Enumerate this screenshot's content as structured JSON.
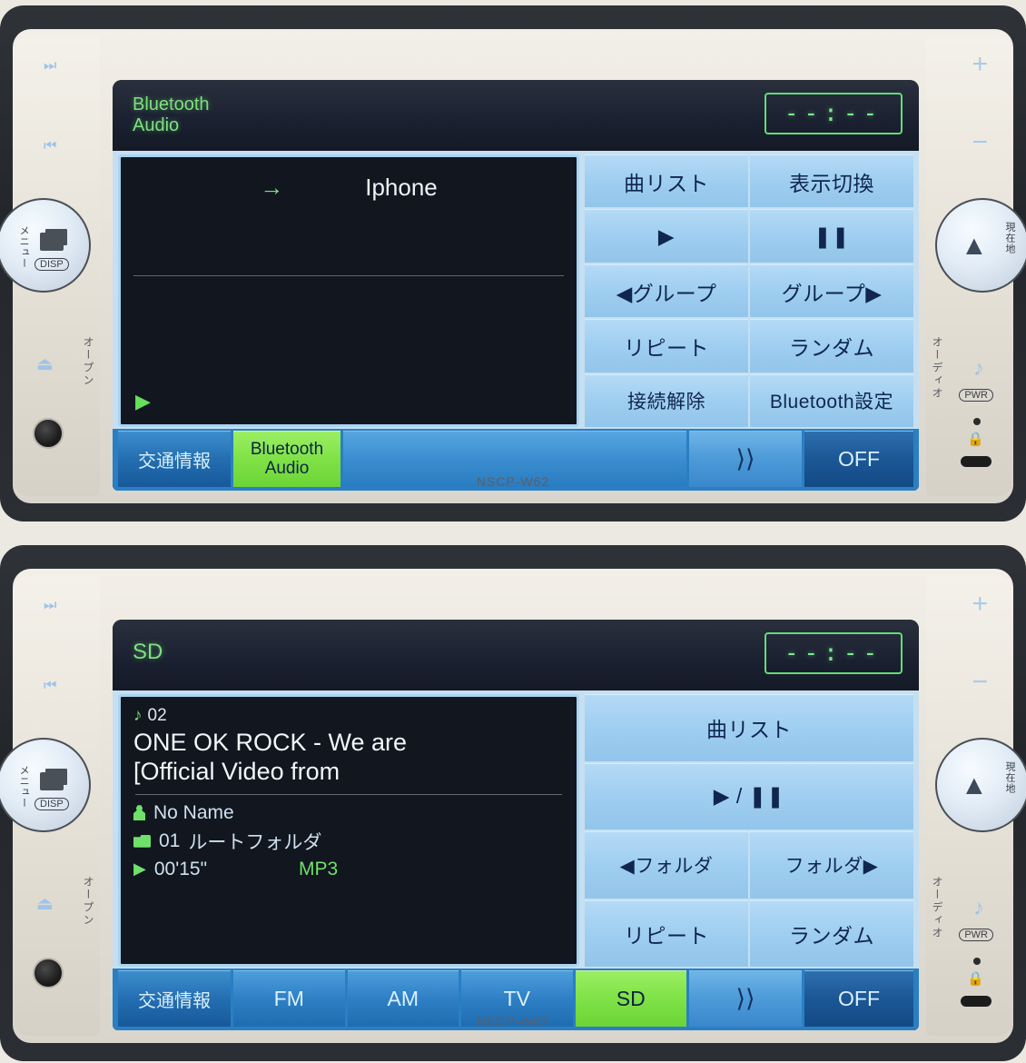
{
  "model_label": "NSCP-W62",
  "units": [
    {
      "id": "bluetooth-audio-unit",
      "source_title": "Bluetooth\nAudio",
      "source_title_line1": "Bluetooth",
      "source_title_line2": "Audio",
      "clock": "--:--",
      "info": {
        "mode": "bluetooth",
        "arrow_icon": "→",
        "device_name": "Iphone",
        "play_icon": "▶"
      },
      "function_buttons": [
        [
          {
            "label": "曲リスト",
            "name": "track-list-button"
          },
          {
            "label": "表示切換",
            "name": "display-switch-button"
          }
        ],
        [
          {
            "label": "▶",
            "name": "play-button"
          },
          {
            "label": "❚❚",
            "name": "pause-button"
          }
        ],
        [
          {
            "label": "◀グループ",
            "name": "group-prev-button"
          },
          {
            "label": "グループ▶",
            "name": "group-next-button"
          }
        ],
        [
          {
            "label": "リピート",
            "name": "repeat-button"
          },
          {
            "label": "ランダム",
            "name": "random-button"
          }
        ],
        [
          {
            "label": "接続解除",
            "name": "disconnect-button"
          },
          {
            "label": "Bluetooth設定",
            "name": "bluetooth-settings-button"
          }
        ]
      ],
      "source_bar": {
        "traffic": "交通情報",
        "items": [
          {
            "label": "Bluetooth Audio",
            "line1": "Bluetooth",
            "line2": "Audio",
            "active": true,
            "name": "source-bluetooth-audio"
          }
        ],
        "next": "⟩⟩",
        "off": "OFF"
      }
    },
    {
      "id": "sd-unit",
      "source_title_line1": "SD",
      "source_title_line2": "",
      "clock": "--:--",
      "info": {
        "mode": "sd",
        "track_number": "02",
        "note_icon": "♪",
        "title_line1": "ONE OK ROCK - We are",
        "title_line2": "[Official Video from",
        "artist": "No Name",
        "folder_number": "01",
        "folder_name": "ルートフォルダ",
        "elapsed_time": "00'15\"",
        "format": "MP3",
        "play_icon": "▶"
      },
      "function_buttons": [
        [
          {
            "label": "曲リスト",
            "name": "track-list-button",
            "full": true
          }
        ],
        [
          {
            "label": "▶ / ❚❚",
            "name": "play-pause-button",
            "full": true
          }
        ],
        [
          {
            "label": "◀フォルダ",
            "name": "folder-prev-button"
          },
          {
            "label": "フォルダ▶",
            "name": "folder-next-button"
          }
        ],
        [
          {
            "label": "リピート",
            "name": "repeat-button"
          },
          {
            "label": "ランダム",
            "name": "random-button"
          }
        ]
      ],
      "source_bar": {
        "traffic": "交通情報",
        "items": [
          {
            "label": "FM",
            "active": false,
            "name": "source-fm"
          },
          {
            "label": "AM",
            "active": false,
            "name": "source-am"
          },
          {
            "label": "TV",
            "active": false,
            "name": "source-tv"
          },
          {
            "label": "SD",
            "active": true,
            "name": "source-sd"
          }
        ],
        "next": "⟩⟩",
        "off": "OFF"
      }
    }
  ],
  "hardware": {
    "left": {
      "track_next_icon": "⏭",
      "track_prev_icon": "⏮",
      "menu_label": "メニュー",
      "disp_label": "DISP",
      "open_label": "オープン",
      "eject_icon": "⏏"
    },
    "right": {
      "volume_up_icon": "+",
      "volume_down_icon": "−",
      "current_location_label": "現在地",
      "audio_label": "オーディオ",
      "power_note_icon": "♪",
      "power_label": "PWR",
      "lock_icon": "🔒"
    }
  },
  "colors": {
    "active_green": "#7fe246",
    "screen_blue": "#9dcdf0",
    "bar_blue": "#2f80c6",
    "display_dark": "#11161f",
    "title_green": "#7ee07e"
  }
}
